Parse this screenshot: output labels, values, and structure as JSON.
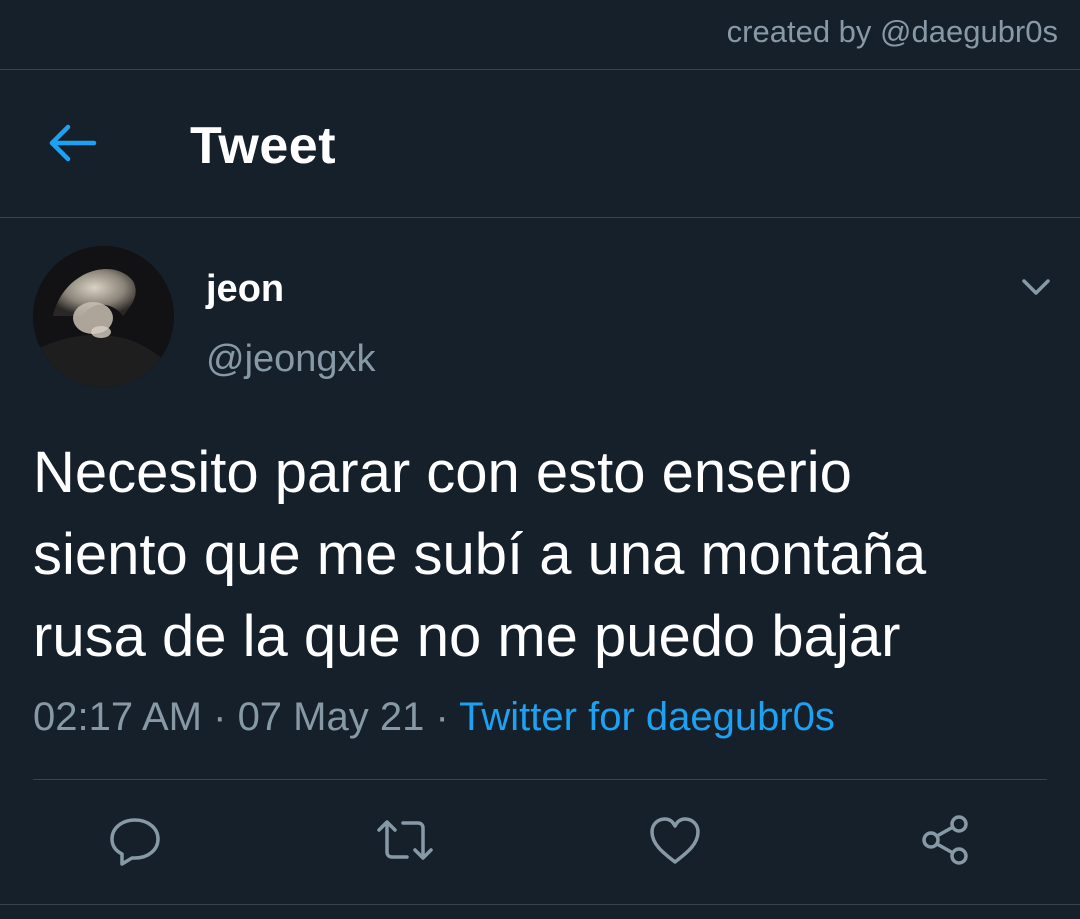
{
  "watermark": "created by @daegubr0s",
  "header": {
    "title": "Tweet",
    "back_icon": "arrow-left-icon"
  },
  "tweet": {
    "author": {
      "display_name": "jeon",
      "handle": "@jeongxk"
    },
    "text_lines": [
      "Necesito parar con esto enserio",
      "siento que me subí a una montaña",
      "rusa de la que no me puedo bajar"
    ],
    "time": "02:17 AM",
    "separator": " · ",
    "date": "07 May 21",
    "source": "Twitter for daegubr0s"
  },
  "actions": [
    {
      "icon": "reply-icon"
    },
    {
      "icon": "retweet-icon"
    },
    {
      "icon": "like-icon"
    },
    {
      "icon": "share-icon"
    }
  ],
  "colors": {
    "background": "#15202b",
    "divider": "#38444d",
    "muted_text": "#8899a6",
    "accent": "#1da1f2",
    "primary_text": "#ffffff"
  }
}
